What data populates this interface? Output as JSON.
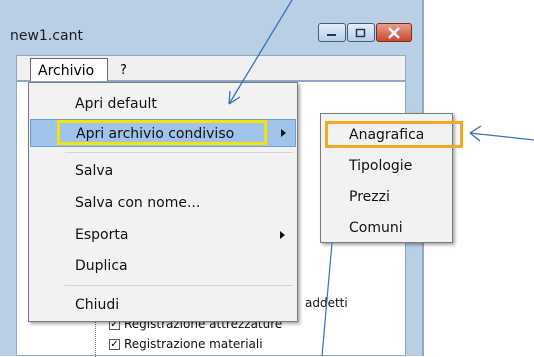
{
  "window": {
    "title": "new1.cant"
  },
  "menubar": {
    "archivio": "Archivio",
    "help": "?"
  },
  "dropdown": {
    "items": [
      {
        "label": "Apri default",
        "submenu": false
      },
      {
        "label": "Apri archivio condiviso",
        "submenu": true,
        "highlighted": true
      },
      {
        "label": "Salva",
        "submenu": false
      },
      {
        "label": "Salva con nome...",
        "submenu": false
      },
      {
        "label": "Esporta",
        "submenu": true
      },
      {
        "label": "Duplica",
        "submenu": false
      },
      {
        "label": "Chiudi",
        "submenu": false
      }
    ]
  },
  "submenu": {
    "items": [
      {
        "label": "Anagrafica",
        "highlighted": true
      },
      {
        "label": "Tipologie"
      },
      {
        "label": "Prezzi"
      },
      {
        "label": "Comuni"
      }
    ]
  },
  "tree": {
    "items": [
      {
        "label": "addetti"
      },
      {
        "label": "Registrazione attrezzature"
      },
      {
        "label": "Registrazione materiali"
      }
    ]
  },
  "annotations": {
    "highlight_color_primary": "#f4e20a",
    "highlight_color_secondary": "#f5a623",
    "arrow_color": "#3b6fb6"
  }
}
